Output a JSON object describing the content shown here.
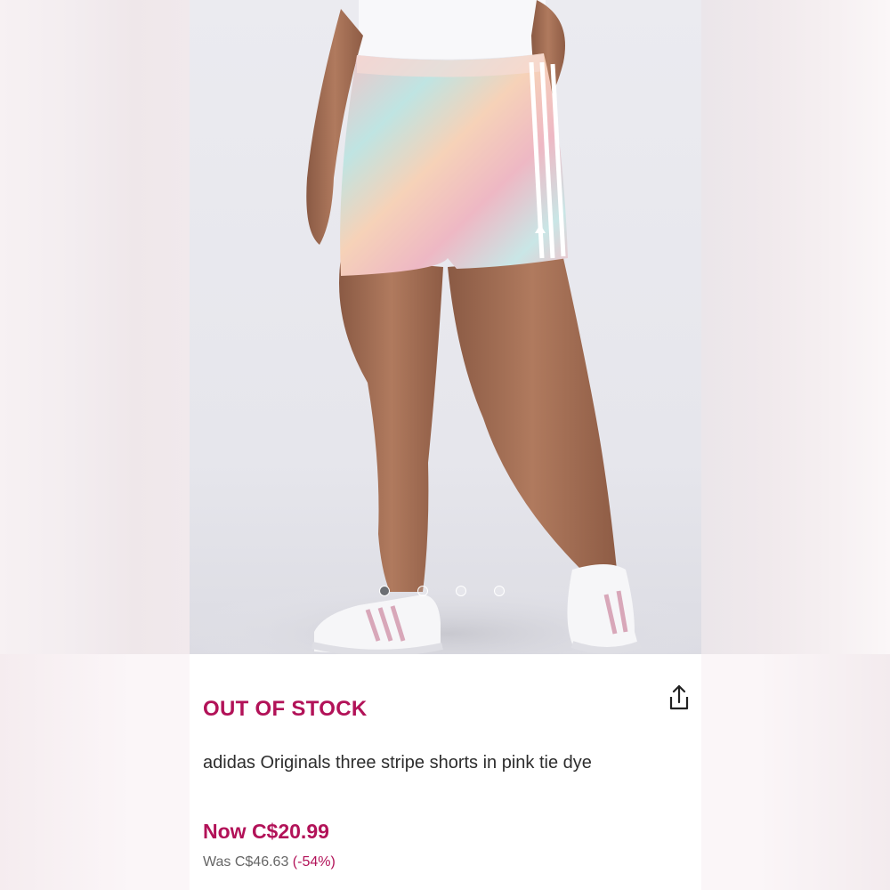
{
  "product": {
    "stock_status": "OUT OF STOCK",
    "title": "adidas Originals three stripe shorts in pink tie dye",
    "price_now": "Now C$20.99",
    "price_was": "Was C$46.63",
    "discount": "(-54%)"
  },
  "carousel": {
    "total_slides": 4,
    "active_slide": 1
  },
  "colors": {
    "accent": "#b21258",
    "text": "#2d2d2d",
    "muted": "#666666"
  },
  "icons": {
    "share": "share-icon"
  }
}
